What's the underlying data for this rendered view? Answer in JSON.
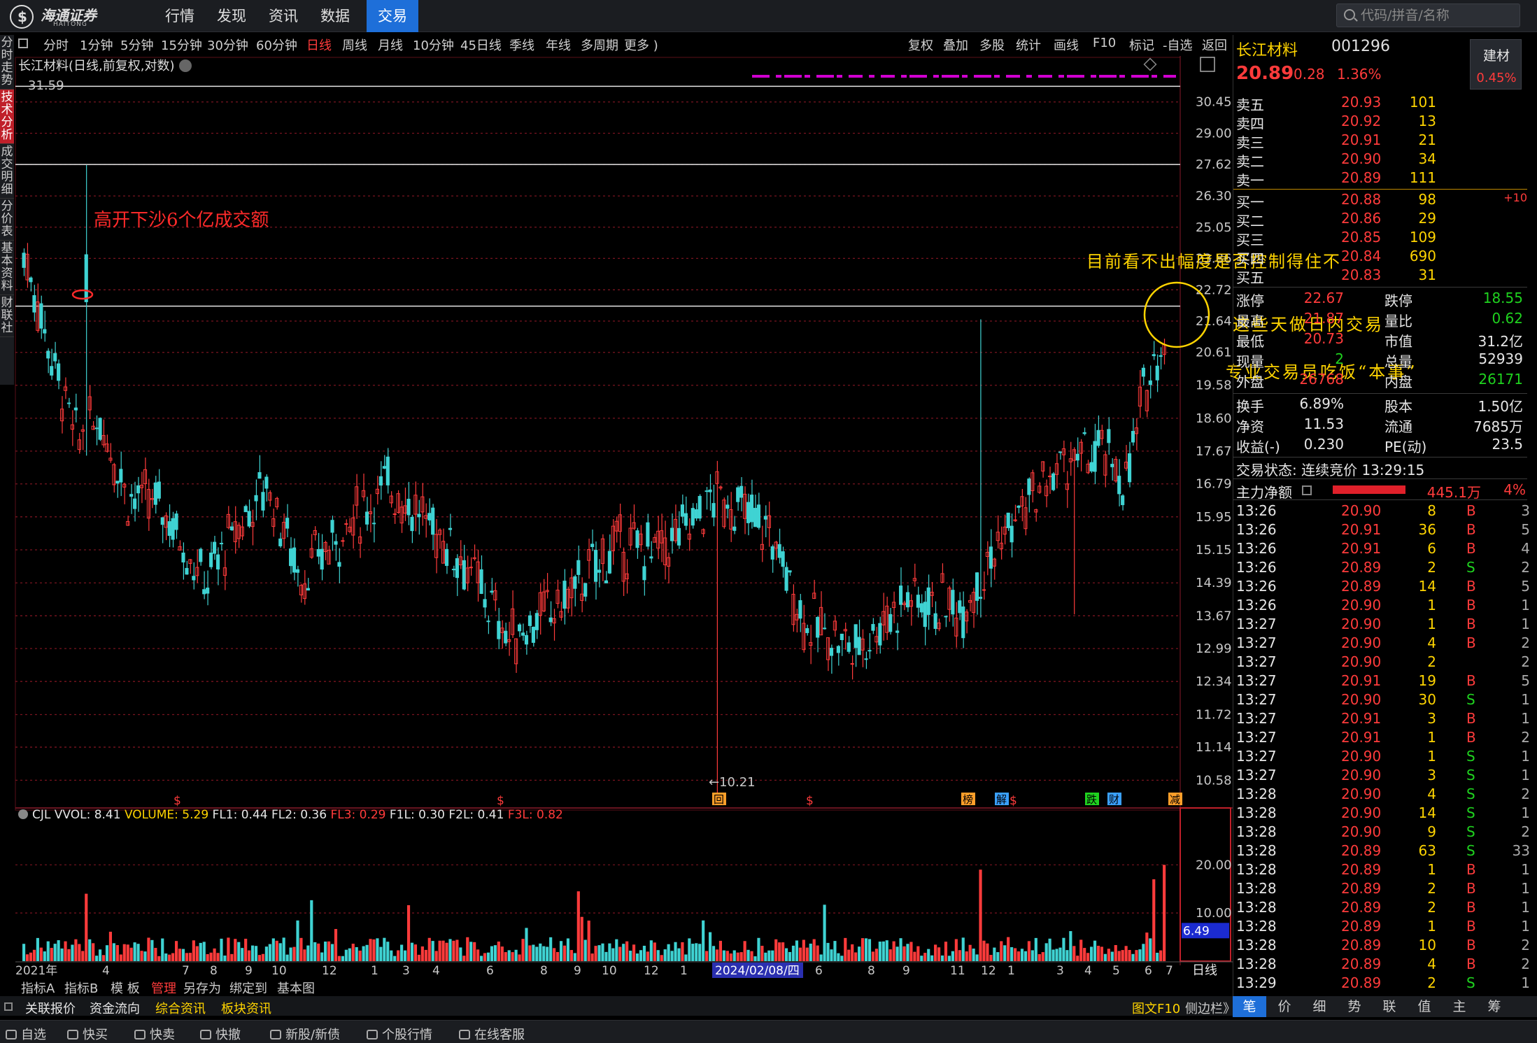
{
  "app": {
    "brand": "海通证券",
    "brand_sub": "HAITONG",
    "nav": [
      "行情",
      "发现",
      "资讯",
      "数据",
      "交易"
    ],
    "active_nav": "交易",
    "search_placeholder": "代码/拼音/名称"
  },
  "left_tabs": [
    "分时走势",
    "技术分析",
    "成交明细",
    "分价表",
    "基本资料",
    "财联社"
  ],
  "period_bar": {
    "items": [
      "分时",
      "1分钟",
      "5分钟",
      "15分钟",
      "30分钟",
      "60分钟",
      "日线",
      "周线",
      "月线",
      "10分钟",
      "45日线",
      "季线",
      "年线",
      "多周期",
      "更多 )"
    ],
    "active": "日线",
    "right_items": [
      "复权",
      "叠加",
      "多股",
      "统计",
      "画线",
      "F10",
      "标记",
      "-自选",
      "返回"
    ]
  },
  "chart": {
    "header": "长江材料(日线,前复权,对数)",
    "price_labels": [
      "30.45",
      "29.00",
      "27.62",
      "26.30",
      "25.05",
      "23.86",
      "22.72",
      "21.64",
      "20.61",
      "19.58",
      "18.60",
      "17.67",
      "16.79",
      "15.95",
      "15.15",
      "14.39",
      "13.67",
      "12.99",
      "12.34",
      "11.72",
      "11.14",
      "10.58"
    ],
    "price_lines": [
      30.45,
      29.0,
      27.62,
      26.3,
      25.05,
      23.86,
      22.72,
      21.64,
      20.61,
      19.58,
      18.6,
      17.67,
      16.79,
      15.95,
      15.15,
      14.39,
      13.67,
      12.99,
      12.34,
      11.72,
      11.14,
      10.58
    ],
    "high_label": "31.59",
    "low_label": "←10.21",
    "event_marks": [
      {
        "text": "$",
        "color": "#ff3b3b"
      },
      {
        "text": "$",
        "color": "#ff3b3b"
      },
      {
        "text": "回",
        "color": "#ff9f2a"
      },
      {
        "text": "$",
        "color": "#ff3b3b"
      },
      {
        "text": "榜",
        "color": "#ff9f2a"
      },
      {
        "text": "解",
        "color": "#3aa0ff"
      },
      {
        "text": "$",
        "color": "#ff3b3b"
      },
      {
        "text": "跌",
        "color": "#1fd21f"
      },
      {
        "text": "财",
        "color": "#3aa0ff"
      },
      {
        "text": "减",
        "color": "#ff9f2a"
      }
    ]
  },
  "annotations": {
    "a1": "高开下沙6个亿成交额",
    "a2": "目前看不出幅度是否控制得住不",
    "a3": "这些天做日内交易",
    "a4": "专业交易员吃饭“本事”"
  },
  "volume": {
    "title": "CJL",
    "legend": [
      {
        "text": "VVOL: 8.41",
        "color": "#e6e6e6"
      },
      {
        "text": "VOLUME: 5.29",
        "color": "#ffd400"
      },
      {
        "text": "FL1: 0.44",
        "color": "#e6e6e6"
      },
      {
        "text": "FL2: 0.36",
        "color": "#e6e6e6"
      },
      {
        "text": "FL3: 0.29",
        "color": "#ff3b3b"
      },
      {
        "text": "F1L: 0.30",
        "color": "#e6e6e6"
      },
      {
        "text": "F2L: 0.41",
        "color": "#e6e6e6"
      },
      {
        "text": "F3L: 0.82",
        "color": "#ff3b3b"
      }
    ],
    "labels": [
      "20.00",
      "10.00"
    ],
    "current": "6.49"
  },
  "date_axis": {
    "labels": [
      "2021年",
      "4",
      "7",
      "8",
      "9",
      "10",
      "12",
      "1",
      "3",
      "4",
      "6",
      "8",
      "9",
      "10",
      "12",
      "1",
      "6",
      "8",
      "9",
      "11",
      "12",
      "1",
      "3",
      "4",
      "5",
      "6",
      "7"
    ],
    "cursor": "2024/02/08/四",
    "period": "日线"
  },
  "bottom_tabs": [
    "指标A",
    "指标B",
    "模 板",
    "管理",
    "另存为",
    "绑定到",
    "基本图"
  ],
  "bottom_active": "管理",
  "news_tabs": [
    {
      "text": "关联报价",
      "color": "#e6e6e6"
    },
    {
      "text": "资金流向",
      "color": "#e6e6e6"
    },
    {
      "text": "综合资讯",
      "color": "#ffd400"
    },
    {
      "text": "板块资讯",
      "color": "#ffd400"
    }
  ],
  "news_right": [
    "图文F10",
    "侧边栏》"
  ],
  "statusbar": [
    "自选",
    "快买",
    "快卖",
    "快撤",
    "新股/新债",
    "个股行情",
    "在线客服"
  ],
  "quote": {
    "name": "长江材料",
    "code": "001296",
    "price": "20.89",
    "change": "0.28",
    "pct": "1.36%",
    "sector": "建材",
    "sector_pct": "0.45%",
    "sells": [
      {
        "label": "卖五",
        "price": "20.93",
        "vol": "101"
      },
      {
        "label": "卖四",
        "price": "20.92",
        "vol": "13"
      },
      {
        "label": "卖三",
        "price": "20.91",
        "vol": "21"
      },
      {
        "label": "卖二",
        "price": "20.90",
        "vol": "34"
      },
      {
        "label": "卖一",
        "price": "20.89",
        "vol": "111"
      }
    ],
    "buys": [
      {
        "label": "买一",
        "price": "20.88",
        "vol": "98",
        "extra": "+10"
      },
      {
        "label": "买二",
        "price": "20.86",
        "vol": "29",
        "extra": ""
      },
      {
        "label": "买三",
        "price": "20.85",
        "vol": "109",
        "extra": ""
      },
      {
        "label": "买四",
        "price": "20.84",
        "vol": "690",
        "extra": ""
      },
      {
        "label": "买五",
        "price": "20.83",
        "vol": "31",
        "extra": ""
      }
    ],
    "stats": [
      {
        "l1": "涨停",
        "v1": "22.67",
        "c1": "red",
        "l2": "跌停",
        "v2": "18.55",
        "c2": "green"
      },
      {
        "l1": "最高",
        "v1": "21.87",
        "c1": "red",
        "l2": "量比",
        "v2": "0.62",
        "c2": "green"
      },
      {
        "l1": "最低",
        "v1": "20.73",
        "c1": "red",
        "l2": "市值",
        "v2": "31.2亿",
        "c2": "white"
      },
      {
        "l1": "现量",
        "v1": "2",
        "c1": "green",
        "l2": "总量",
        "v2": "52939",
        "c2": "white"
      },
      {
        "l1": "外盘",
        "v1": "26768",
        "c1": "red",
        "l2": "内盘",
        "v2": "26171",
        "c2": "green"
      }
    ],
    "stats2": [
      {
        "l1": "换手",
        "v1": "6.89%",
        "l2": "股本",
        "v2": "1.50亿"
      },
      {
        "l1": "净资",
        "v1": "11.53",
        "l2": "流通",
        "v2": "7685万"
      },
      {
        "l1": "收益(-)",
        "v1": "0.230",
        "l2": "PE(动)",
        "v2": "23.5"
      }
    ],
    "trade_status": "交易状态: 连续竞价 13:29:15",
    "main_flow_label": "主力净额",
    "main_flow_value": "445.1万",
    "main_flow_pct": "4%",
    "ticks": [
      {
        "t": "13:26",
        "p": "20.90",
        "v": "8",
        "bs": "B",
        "n": "3"
      },
      {
        "t": "13:26",
        "p": "20.91",
        "v": "36",
        "bs": "B",
        "n": "5"
      },
      {
        "t": "13:26",
        "p": "20.91",
        "v": "6",
        "bs": "B",
        "n": "4"
      },
      {
        "t": "13:26",
        "p": "20.89",
        "v": "2",
        "bs": "S",
        "n": "2"
      },
      {
        "t": "13:26",
        "p": "20.89",
        "v": "14",
        "bs": "B",
        "n": "5"
      },
      {
        "t": "13:26",
        "p": "20.90",
        "v": "1",
        "bs": "B",
        "n": "1"
      },
      {
        "t": "13:27",
        "p": "20.90",
        "v": "1",
        "bs": "B",
        "n": "1"
      },
      {
        "t": "13:27",
        "p": "20.90",
        "v": "4",
        "bs": "B",
        "n": "2"
      },
      {
        "t": "13:27",
        "p": "20.90",
        "v": "2",
        "bs": "",
        "n": "2"
      },
      {
        "t": "13:27",
        "p": "20.91",
        "v": "19",
        "bs": "B",
        "n": "5"
      },
      {
        "t": "13:27",
        "p": "20.90",
        "v": "30",
        "bs": "S",
        "n": "1"
      },
      {
        "t": "13:27",
        "p": "20.91",
        "v": "3",
        "bs": "B",
        "n": "1"
      },
      {
        "t": "13:27",
        "p": "20.91",
        "v": "1",
        "bs": "B",
        "n": "2"
      },
      {
        "t": "13:27",
        "p": "20.90",
        "v": "1",
        "bs": "S",
        "n": "1"
      },
      {
        "t": "13:27",
        "p": "20.90",
        "v": "3",
        "bs": "S",
        "n": "1"
      },
      {
        "t": "13:28",
        "p": "20.90",
        "v": "4",
        "bs": "S",
        "n": "2"
      },
      {
        "t": "13:28",
        "p": "20.90",
        "v": "14",
        "bs": "S",
        "n": "1"
      },
      {
        "t": "13:28",
        "p": "20.90",
        "v": "9",
        "bs": "S",
        "n": "2"
      },
      {
        "t": "13:28",
        "p": "20.89",
        "v": "63",
        "bs": "S",
        "n": "33"
      },
      {
        "t": "13:28",
        "p": "20.89",
        "v": "1",
        "bs": "B",
        "n": "1"
      },
      {
        "t": "13:28",
        "p": "20.89",
        "v": "2",
        "bs": "B",
        "n": "1"
      },
      {
        "t": "13:28",
        "p": "20.89",
        "v": "2",
        "bs": "B",
        "n": "1"
      },
      {
        "t": "13:28",
        "p": "20.89",
        "v": "1",
        "bs": "B",
        "n": "1"
      },
      {
        "t": "13:28",
        "p": "20.89",
        "v": "10",
        "bs": "B",
        "n": "2"
      },
      {
        "t": "13:28",
        "p": "20.89",
        "v": "4",
        "bs": "B",
        "n": "2"
      },
      {
        "t": "13:29",
        "p": "20.89",
        "v": "2",
        "bs": "S",
        "n": "1"
      }
    ],
    "bottom_tabs": [
      "笔",
      "价",
      "细",
      "势",
      "联",
      "值",
      "主",
      "筹"
    ],
    "bottom_active": "笔"
  },
  "colors": {
    "up": "#ff3b3b",
    "down": "#3fd3d3",
    "grid": "#7a1420",
    "accent": "#1e6fd9",
    "annotation": "#ffd400",
    "annotation_red": "#ff2a2a"
  }
}
